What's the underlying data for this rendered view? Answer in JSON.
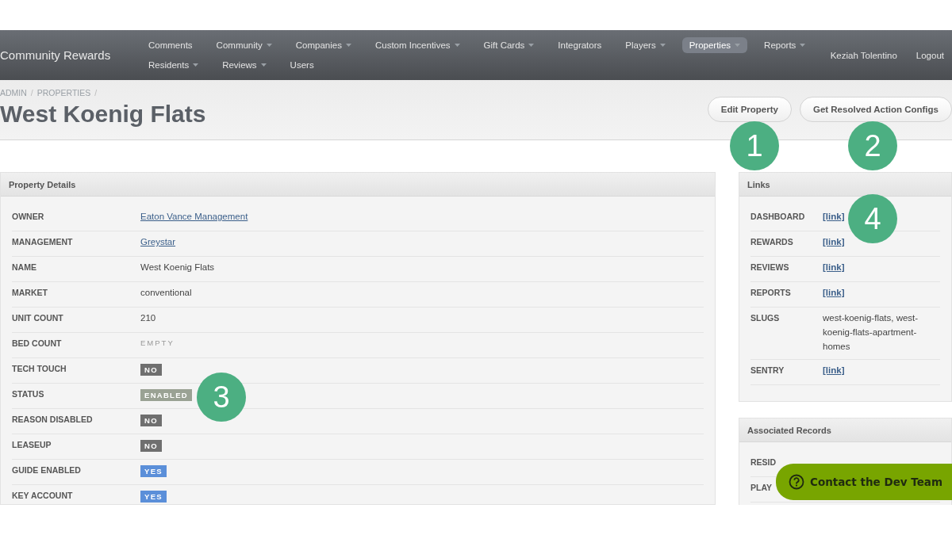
{
  "navbar": {
    "brand": "Community Rewards",
    "rows": [
      [
        {
          "label": "Comments",
          "dropdown": false,
          "selected": false
        },
        {
          "label": "Community",
          "dropdown": true,
          "selected": false
        },
        {
          "label": "Companies",
          "dropdown": true,
          "selected": false
        },
        {
          "label": "Custom Incentives",
          "dropdown": true,
          "selected": false
        },
        {
          "label": "Gift Cards",
          "dropdown": true,
          "selected": false
        },
        {
          "label": "Integrators",
          "dropdown": false,
          "selected": false
        },
        {
          "label": "Players",
          "dropdown": true,
          "selected": false
        },
        {
          "label": "Properties",
          "dropdown": true,
          "selected": true
        },
        {
          "label": "Reports",
          "dropdown": true,
          "selected": false
        }
      ],
      [
        {
          "label": "Residents",
          "dropdown": true,
          "selected": false
        },
        {
          "label": "Reviews",
          "dropdown": true,
          "selected": false
        },
        {
          "label": "Users",
          "dropdown": false,
          "selected": false
        }
      ]
    ],
    "user": "Keziah Tolentino",
    "logout": "Logout"
  },
  "breadcrumb": [
    {
      "label": "ADMIN",
      "separator": "/"
    },
    {
      "label": "PROPERTIES",
      "separator": "/"
    }
  ],
  "title": "West Koenig Flats",
  "actions": [
    "Edit Property",
    "Get Resolved Action Configs"
  ],
  "property_details": {
    "title": "Property Details",
    "rows": [
      {
        "label": "OWNER",
        "kind": "link",
        "value": "Eaton Vance Management"
      },
      {
        "label": "MANAGEMENT",
        "kind": "link",
        "value": "Greystar"
      },
      {
        "label": "NAME",
        "kind": "text",
        "value": "West Koenig Flats"
      },
      {
        "label": "MARKET",
        "kind": "text",
        "value": "conventional"
      },
      {
        "label": "UNIT COUNT",
        "kind": "text",
        "value": "210"
      },
      {
        "label": "BED COUNT",
        "kind": "empty",
        "value": "EMPTY"
      },
      {
        "label": "TECH TOUCH",
        "kind": "badge",
        "value": "NO",
        "color": "#6f6f6f"
      },
      {
        "label": "STATUS",
        "kind": "badge",
        "value": "ENABLED",
        "color": "#9aa294"
      },
      {
        "label": "REASON DISABLED",
        "kind": "badge",
        "value": "NO",
        "color": "#6f6f6f"
      },
      {
        "label": "LEASEUP",
        "kind": "badge",
        "value": "NO",
        "color": "#6f6f6f"
      },
      {
        "label": "GUIDE ENABLED",
        "kind": "badge",
        "value": "YES",
        "color": "#5b8fd9"
      },
      {
        "label": "KEY ACCOUNT",
        "kind": "badge",
        "value": "YES",
        "color": "#5b8fd9"
      }
    ]
  },
  "links": {
    "title": "Links",
    "rows": [
      {
        "label": "DASHBOARD",
        "kind": "link",
        "value": "[link]"
      },
      {
        "label": "REWARDS",
        "kind": "link",
        "value": "[link]"
      },
      {
        "label": "REVIEWS",
        "kind": "link",
        "value": "[link]"
      },
      {
        "label": "REPORTS",
        "kind": "link",
        "value": "[link]"
      },
      {
        "label": "SLUGS",
        "kind": "text",
        "value": "west-koenig-flats, west-koenig-flats-apartment-homes"
      },
      {
        "label": "SENTRY",
        "kind": "link",
        "value": "[link]"
      }
    ]
  },
  "associated_records": {
    "title": "Associated Records",
    "rows": [
      {
        "label": "RESID"
      },
      {
        "label": "PLAY"
      }
    ]
  },
  "contact_button": {
    "label": "Contact the Dev Team"
  },
  "annotations": [
    "1",
    "2",
    "3",
    "4"
  ]
}
